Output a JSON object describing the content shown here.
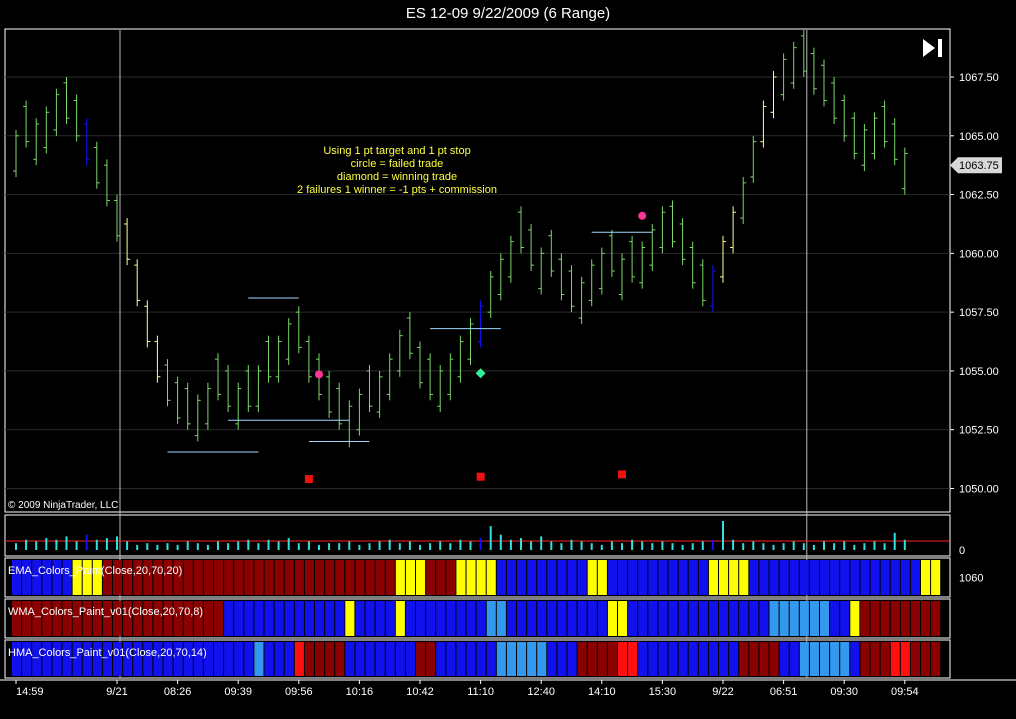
{
  "title": "ES 12-09  9/22/2009 (6 Range)",
  "copyright": "© 2009 NinjaTrader, LLC",
  "current_price_label": "1063.75",
  "annotation": [
    "Using 1 pt target and 1 pt stop",
    "circle = failed trade",
    "diamond = winning trade",
    "2 failures 1 winner = -1 pts + commission"
  ],
  "colors": {
    "up_bar": "#7cd66a",
    "down_bar": "#8fc874",
    "yellow_bar": "#ffff99",
    "blue_bar": "#1010ff",
    "volume": "#33e0e0",
    "annotation_text": "#ffff40",
    "failed_marker": "#ff3399",
    "win_marker": "#33ee99",
    "stop_marker": "#ee1111",
    "level_line": "#a0d8ff",
    "ind_blue": "#1111ee",
    "ind_lightblue": "#3399ee",
    "ind_yellow": "#ffff00",
    "ind_darkred": "#8b0000",
    "ind_red": "#ff1010"
  },
  "chart_data": {
    "type": "bar",
    "price_axis": {
      "ylim": [
        1049.0,
        1069.5
      ],
      "ticks": [
        "1067.50",
        "1065.00",
        "1062.50",
        "1060.00",
        "1057.50",
        "1055.00",
        "1052.50",
        "1050.00"
      ]
    },
    "x_ticks": [
      "14:59",
      "9/21",
      "08:26",
      "09:39",
      "09:56",
      "10:16",
      "10:42",
      "11:10",
      "12:40",
      "14:10",
      "15:30",
      "9/22",
      "06:51",
      "09:30",
      "09:54"
    ],
    "x_tick_bar_index": [
      0,
      10,
      16,
      22,
      28,
      34,
      40,
      46,
      52,
      58,
      64,
      70,
      76,
      82,
      88
    ],
    "session_break_bar_index": [
      10,
      78
    ],
    "closes": [
      1065.0,
      1064.75,
      1065.5,
      1066.0,
      1066.75,
      1065.75,
      1065.0,
      1064.0,
      1063.0,
      1062.25,
      1060.75,
      1059.75,
      1058.0,
      1056.25,
      1054.75,
      1053.75,
      1053.0,
      1052.75,
      1053.75,
      1054.25,
      1054.0,
      1053.5,
      1054.25,
      1053.5,
      1055.0,
      1054.75,
      1056.25,
      1057.0,
      1056.0,
      1054.75,
      1054.0,
      1053.25,
      1052.75,
      1053.5,
      1054.0,
      1053.5,
      1054.75,
      1055.5,
      1056.5,
      1055.75,
      1054.5,
      1054.0,
      1055.0,
      1055.5,
      1056.25,
      1057.0,
      1057.75,
      1059.0,
      1059.75,
      1060.5,
      1060.25,
      1059.5,
      1060.0,
      1059.25,
      1058.25,
      1057.75,
      1058.75,
      1059.5,
      1060.0,
      1059.25,
      1059.75,
      1059.0,
      1060.25,
      1061.0,
      1061.75,
      1060.5,
      1059.75,
      1058.75,
      1058.0,
      1059.25,
      1060.5,
      1061.75,
      1063.0,
      1064.75,
      1066.25,
      1067.5,
      1068.25,
      1068.75,
      1067.75,
      1067.0,
      1066.5,
      1065.75,
      1065.0,
      1064.25,
      1065.25,
      1065.75,
      1064.75,
      1064.0,
      1064.25
    ],
    "bar_color_codes": "GGGGGGGBGGGYYYYGGGGGGGGGGGGGGGGGGGGGGGGGGGGGGGBGGGGGGGGGGGGGGGGGGGGGGBYYGGYYGGGGGGGGGGGGG",
    "levels": [
      {
        "price": 1058.1,
        "from": 23,
        "to": 28,
        "label": ""
      },
      {
        "price": 1052.9,
        "from": 21,
        "to": 33,
        "label": ""
      },
      {
        "price": 1052.0,
        "from": 29,
        "to": 35,
        "label": ""
      },
      {
        "price": 1051.55,
        "from": 15,
        "to": 24,
        "label": ""
      },
      {
        "price": 1056.8,
        "from": 41,
        "to": 48,
        "label": ""
      },
      {
        "price": 1060.9,
        "from": 57,
        "to": 63,
        "label": ""
      }
    ],
    "markers": [
      {
        "shape": "circle",
        "bar": 30,
        "price": 1054.85
      },
      {
        "shape": "circle",
        "bar": 62,
        "price": 1061.6
      },
      {
        "shape": "diamond",
        "bar": 46,
        "price": 1054.9
      },
      {
        "shape": "square",
        "bar": 29,
        "price": 1050.4
      },
      {
        "shape": "square",
        "bar": 46,
        "price": 1050.5
      },
      {
        "shape": "square",
        "bar": 60,
        "price": 1050.6
      }
    ],
    "volume": {
      "zero_label": "0",
      "values": [
        4,
        6,
        5,
        7,
        6,
        8,
        5,
        9,
        6,
        7,
        8,
        5,
        3,
        4,
        3,
        4,
        3,
        5,
        4,
        3,
        5,
        4,
        5,
        6,
        4,
        6,
        5,
        7,
        4,
        5,
        3,
        4,
        4,
        5,
        3,
        4,
        5,
        6,
        4,
        5,
        3,
        4,
        5,
        4,
        6,
        5,
        7,
        14,
        9,
        6,
        7,
        5,
        8,
        5,
        4,
        6,
        5,
        4,
        3,
        5,
        4,
        6,
        5,
        4,
        5,
        4,
        3,
        4,
        5,
        6,
        17,
        6,
        4,
        5,
        4,
        3,
        4,
        5,
        4,
        3,
        5,
        4,
        5,
        3,
        4,
        5,
        4,
        10,
        6
      ]
    },
    "indicators": [
      {
        "name": "EMA_Colors_Paint(Close,20,70,20)",
        "value_label": "1060",
        "codes": "BBBBBBYYYRRRRRRRRRRRRRRRRRRRRRRRRRRRRRYYYRRRYYYYBBBBBBBBBYYBBBBBBBBBBYYYYBBBBBBBBBBBBBBBBBYYY"
      },
      {
        "name": "WMA_Colors_Paint_v01(Close,20,70,8)",
        "value_label": "",
        "codes": "RRRRRRRRRRRRRRRRRRRRRBBBBBBBBBBBBYBBBBYBBBBBBBBLLBBBBBBBBBBYYBBBBBBBBBBBBBBLLLLLLBBYRRRRRRRRR"
      },
      {
        "name": "HMA_Colors_Paint_v01(Close,20,70,14)",
        "value_label": "",
        "codes": "BBBBBBBBBBBBBBBBBBBBBBBBLBBBSRRRRBBBBBBBRRBBBBBBLLLLLBBBRRRRSSBBBBBBBBBBRRRRBBLLLLLBRRRSSRRRR"
      }
    ]
  }
}
